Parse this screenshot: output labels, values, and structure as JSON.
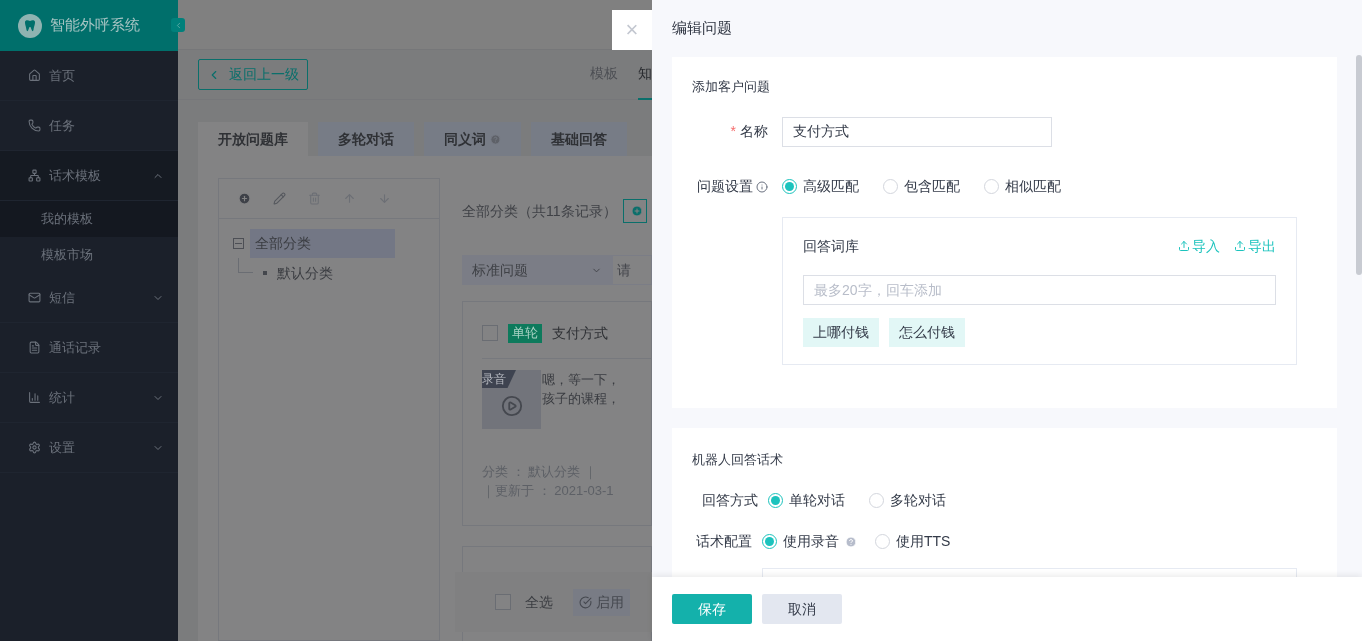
{
  "sidebar": {
    "title": "智能外呼系统",
    "items": [
      {
        "kind": "link",
        "label": "首页"
      },
      {
        "kind": "link",
        "label": "任务"
      },
      {
        "kind": "group",
        "label": "话术模板",
        "expanded": true,
        "children": [
          {
            "label": "我的模板",
            "selected": true
          },
          {
            "label": "模板市场",
            "selected": false
          }
        ]
      },
      {
        "kind": "group",
        "label": "短信",
        "expanded": false
      },
      {
        "kind": "link",
        "label": "通话记录"
      },
      {
        "kind": "group",
        "label": "统计",
        "expanded": false
      },
      {
        "kind": "group",
        "label": "设置",
        "expanded": false
      }
    ]
  },
  "main": {
    "back_button": "返回上一级",
    "top_tabs": [
      {
        "label": "模板",
        "selected": false
      },
      {
        "label": "知",
        "selected": true
      }
    ],
    "tabs": [
      {
        "label": "开放问题库",
        "selected": true
      },
      {
        "label": "多轮对话",
        "selected": false
      },
      {
        "label": "同义词",
        "selected": false,
        "help": true
      },
      {
        "label": "基础回答",
        "selected": false
      }
    ],
    "tree": {
      "items": [
        {
          "label": "全部分类",
          "selected": true,
          "expanded": true,
          "children": [
            {
              "label": "默认分类",
              "selected": false
            }
          ]
        }
      ]
    },
    "list_header": "全部分类（共11条记录）",
    "filter": {
      "select": "标准问题",
      "placeholder": "请"
    },
    "card": {
      "checked": false,
      "tag": "单轮",
      "title": "支付方式",
      "audio_label": "录音",
      "text_lines": [
        "嗯，等一下，",
        "孩子的课程，"
      ],
      "meta_lines": [
        "分类 ： 默认分类 ｜",
        "｜更新于 ： 2021-03-1"
      ]
    },
    "bottom_bar": {
      "checked": false,
      "select_all": "全选",
      "enable_button": "启用",
      "enable_disabled": true
    }
  },
  "drawer": {
    "close": "×",
    "title": "编辑问题",
    "customer_question": {
      "heading": "添加客户问题",
      "name_label": "名称",
      "required_mark": "*",
      "name_value": "支付方式",
      "setting_label": "问题设置",
      "match_options": [
        {
          "label": "高级匹配",
          "selected": true
        },
        {
          "label": "包含匹配",
          "selected": false
        },
        {
          "label": "相似匹配",
          "selected": false
        }
      ],
      "lexicon": {
        "title": "回答词库",
        "import": "导入",
        "export": "导出",
        "placeholder": "最多20字，回车添加",
        "tags": [
          "上哪付钱",
          "怎么付钱"
        ]
      }
    },
    "robot_answer": {
      "heading": "机器人回答话术",
      "mode_label": "回答方式",
      "mode_options": [
        {
          "label": "单轮对话",
          "selected": true
        },
        {
          "label": "多轮对话",
          "selected": false
        }
      ],
      "config_label": "话术配置",
      "config_options": [
        {
          "label": "使用录音",
          "selected": true,
          "help": true
        },
        {
          "label": "使用TTS",
          "selected": false
        }
      ]
    },
    "save": "保存",
    "cancel": "取消"
  }
}
